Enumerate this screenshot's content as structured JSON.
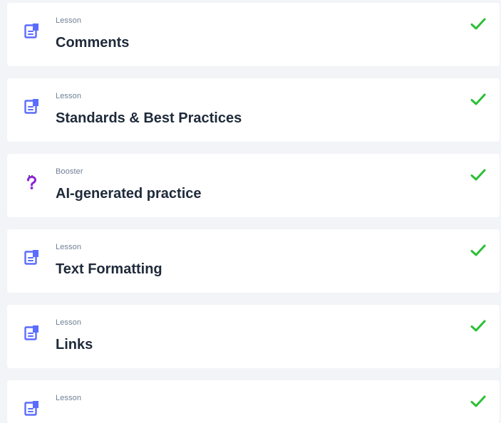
{
  "colors": {
    "page_background": "#f2f4f7",
    "card_background": "#ffffff",
    "lesson_icon": "#5b6cff",
    "booster_icon": "#8a23d9",
    "check": "#2bbf35",
    "label": "#6f7f95",
    "title": "#1f2a3a"
  },
  "items": [
    {
      "type_label": "Lesson",
      "title": "Comments",
      "icon": "document-icon",
      "completed": true
    },
    {
      "type_label": "Lesson",
      "title": "Standards & Best Practices",
      "icon": "document-icon",
      "completed": true
    },
    {
      "type_label": "Booster",
      "title": "AI-generated practice",
      "icon": "question-mark-icon",
      "completed": true
    },
    {
      "type_label": "Lesson",
      "title": "Text Formatting",
      "icon": "document-icon",
      "completed": true
    },
    {
      "type_label": "Lesson",
      "title": "Links",
      "icon": "document-icon",
      "completed": true
    },
    {
      "type_label": "Lesson",
      "title": "",
      "icon": "document-icon",
      "completed": true
    }
  ]
}
